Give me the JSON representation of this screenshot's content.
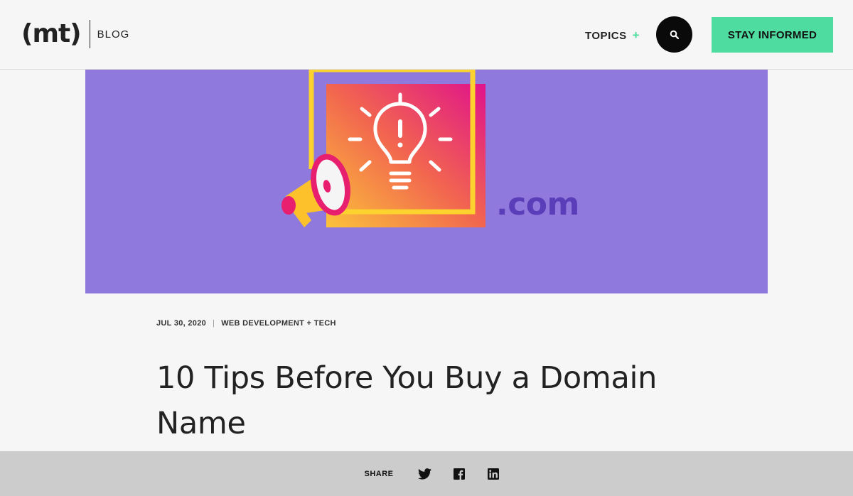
{
  "header": {
    "logo_text": "(mt)",
    "section_label": "BLOG",
    "topics_label": "TOPICS",
    "topics_plus": "+",
    "search_icon": "search-icon",
    "cta_label": "STAY INFORMED"
  },
  "hero": {
    "domain_text": ".com",
    "background_color": "#9079dc"
  },
  "article": {
    "date": "JUL 30, 2020",
    "separator": "|",
    "category": "WEB DEVELOPMENT + TECH",
    "title": "10 Tips Before You Buy a Domain Name"
  },
  "share": {
    "label": "SHARE",
    "icons": [
      "twitter-icon",
      "facebook-icon",
      "linkedin-icon"
    ]
  },
  "colors": {
    "accent": "#4fdca0",
    "page_bg": "#f6f6f6",
    "share_bar_bg": "#cccccc"
  }
}
